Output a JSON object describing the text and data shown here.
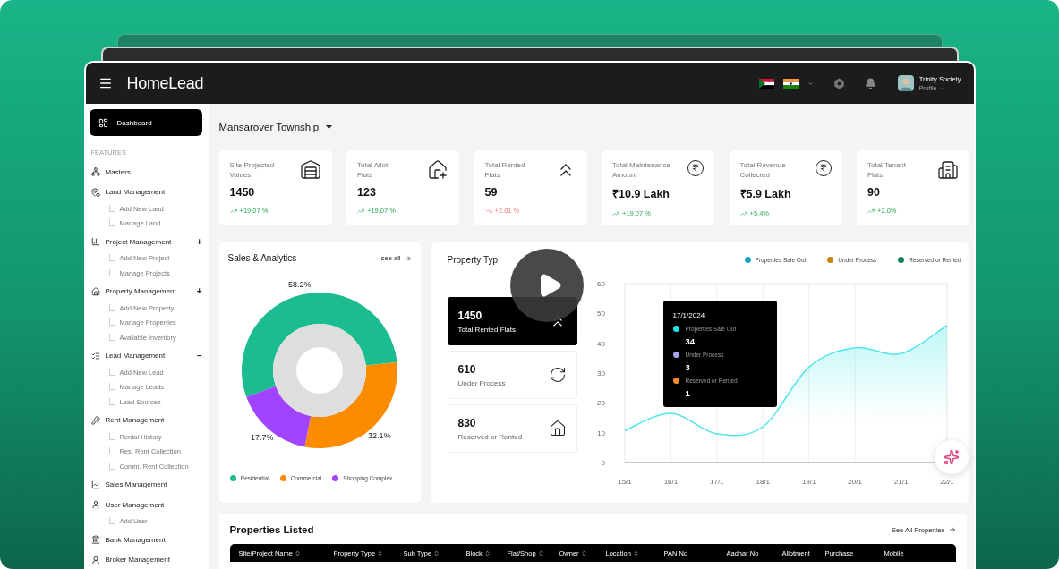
{
  "header": {
    "logo": "HomeLead",
    "user": {
      "name": "Trinity Society",
      "role": "Profile"
    }
  },
  "sidebar": {
    "dashboard": {
      "label": "Dashboard",
      "selected": true
    },
    "section": "FEATURES",
    "groups": [
      {
        "label": "Masters"
      },
      {
        "label": "Land Management",
        "children": [
          "Add New Land",
          "Manage Land"
        ]
      },
      {
        "label": "Project Management",
        "toggle": "+",
        "children": [
          "Add New Project",
          "Manage Projects"
        ]
      },
      {
        "label": "Property Management",
        "toggle": "+",
        "children": [
          "Add New Property",
          "Manage Properties",
          "Available Inventory"
        ]
      },
      {
        "label": "Lead Management",
        "toggle": "–",
        "children": [
          "Add New Lead",
          "Manage Leads",
          "Lead Sources"
        ]
      },
      {
        "label": "Rent Management",
        "children": [
          "Rental History",
          "Res. Rent Collection",
          "Comm. Rent Collection"
        ]
      },
      {
        "label": "Sales Management"
      },
      {
        "label": "User Management",
        "children": [
          "Add User"
        ]
      },
      {
        "label": "Bank Management"
      },
      {
        "label": "Broker Management"
      }
    ]
  },
  "project": {
    "title": "Mansarover Township"
  },
  "stats": [
    {
      "label": "Site Projected\nValues",
      "value": "1450",
      "change": "+19.07 %",
      "positive": true
    },
    {
      "label": "Total Allot\nFlats",
      "value": "123",
      "change": "+19.07 %",
      "positive": true
    },
    {
      "label": "Total Rented\nFlats",
      "value": "59",
      "change": "+2.01 %",
      "positive": false
    },
    {
      "label": "Total Maintenance\nAmount",
      "value": "₹10.9 Lakh",
      "change": "+19.07 %",
      "positive": true
    },
    {
      "label": "Total Revenue\nCollected",
      "value": "₹5.9 Lakh",
      "change": "+5.4%",
      "positive": true
    },
    {
      "label": "Total Tenant\nFlats",
      "value": "90",
      "change": "+2.0%",
      "positive": true
    }
  ],
  "sales": {
    "title": "Sales & Analytics",
    "link": "see all",
    "chart_data": {
      "type": "donut",
      "categories": [
        "Residential",
        "Commercial",
        "Shopping Complex"
      ],
      "values": [
        58.2,
        32.1,
        17.7
      ],
      "colors": [
        "#1bbc8f",
        "#fb8c00",
        "#a044ff"
      ],
      "value_labels": [
        "58.2%",
        "32.1%",
        "17.7%"
      ]
    }
  },
  "property_type": {
    "title": "Property Typ",
    "legend": [
      {
        "label": "Properties Sale Out",
        "color": "#1aa3c7"
      },
      {
        "label": "Under Process",
        "color": "#c98510"
      },
      {
        "label": "Reserved or Rented",
        "color": "#15805e"
      }
    ],
    "stats": [
      {
        "value": "1450",
        "label": "Total Rented Flats",
        "selected": true
      },
      {
        "value": "610",
        "label": "Under Process",
        "selected": false
      },
      {
        "value": "830",
        "label": "Reserved or Rented",
        "selected": false
      }
    ],
    "chart_data": {
      "type": "area",
      "categories": [
        "15/1",
        "16/1",
        "17/1",
        "18/1",
        "19/1",
        "20/1",
        "21/1",
        "22/1"
      ],
      "series": [
        {
          "color": "#4ee6ea",
          "values": [
            10.7,
            16.5,
            9.6,
            12,
            32,
            38.5,
            36.5,
            46
          ]
        }
      ],
      "grid": true,
      "ylim": [
        0,
        60
      ],
      "yticks": [
        0,
        10,
        20,
        30,
        40,
        50,
        60
      ]
    },
    "tooltip": {
      "date": "17/1/2024",
      "items": [
        {
          "label": "Properties Sale Out",
          "value": "34",
          "color": "#22e5e8"
        },
        {
          "label": "Under Process",
          "value": "3",
          "color": "#a7a3f0"
        },
        {
          "label": "Reserved or Rented",
          "value": "1",
          "color": "#f08a2c"
        }
      ]
    }
  },
  "properties": {
    "title": "Properties Listed",
    "link": "See All Properties",
    "columns": [
      {
        "label": "Site/Project Name",
        "sortable": true
      },
      {
        "label": "Property Type",
        "sortable": true
      },
      {
        "label": "Sub Type",
        "sortable": true
      },
      {
        "label": "Block",
        "sortable": true
      },
      {
        "label": "Flat/Shop",
        "sortable": true
      },
      {
        "label": "Owner",
        "sortable": true
      },
      {
        "label": "Location",
        "sortable": true
      },
      {
        "label": "PAN No",
        "sortable": false
      },
      {
        "label": "Aadhar No",
        "sortable": false
      },
      {
        "label": "Allotment",
        "sortable": false
      },
      {
        "label": "Purchase",
        "sortable": false
      },
      {
        "label": "Mobile",
        "sortable": false
      }
    ]
  }
}
